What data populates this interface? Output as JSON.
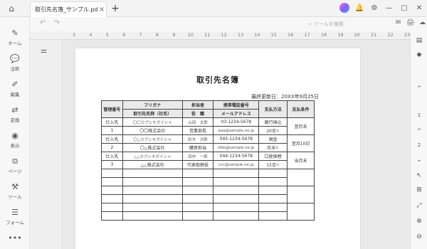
{
  "titlebar": {
    "tab_title": "取引先名簿_サンプル.pdf",
    "tab_close": "×",
    "tab_add": "+",
    "home_icon": "⌂",
    "right_icons": [
      "bell-icon",
      "gear-icon",
      "minimize-icon",
      "restore-icon",
      "close-icon"
    ],
    "right_glyphs": [
      "🔔",
      "⚙",
      "—",
      "▢",
      "✕"
    ]
  },
  "sidebar": {
    "items": [
      {
        "icon": "✎",
        "label": "ホーム",
        "name": "home"
      },
      {
        "icon": "💬",
        "label": "注釈",
        "name": "annotate"
      },
      {
        "icon": "✐",
        "label": "編集",
        "name": "edit"
      },
      {
        "icon": "⇄",
        "label": "変換",
        "name": "convert"
      },
      {
        "icon": "◉",
        "label": "表示",
        "name": "view"
      },
      {
        "icon": "⧉",
        "label": "ページ",
        "name": "page"
      },
      {
        "icon": "⚒",
        "label": "ツール",
        "name": "tool"
      },
      {
        "icon": "☰",
        "label": "フォーム",
        "name": "form"
      },
      {
        "icon": "•••",
        "label": "",
        "name": "more"
      }
    ]
  },
  "toolbar": {
    "undo": "↶",
    "redo": "↷",
    "search_placeholder": "ツールを検索",
    "right": [
      "✉",
      "🖨",
      "☁",
      "⤓"
    ]
  },
  "ruler": {
    "numbers": [
      "3",
      "4",
      "5",
      "6",
      "7",
      "8",
      "9",
      "10",
      "11",
      "12",
      "13",
      "14",
      "15",
      "16",
      "17",
      "18",
      "19",
      "20",
      "21",
      "22",
      "23"
    ]
  },
  "document": {
    "title": "取引先名簿",
    "updated": "最終更新日：20XX年9月25日",
    "headers": {
      "mgmt": "管理番号",
      "furigana": "フリガナ",
      "company": "取引先名称（社名）",
      "person": "担当者",
      "position": "役　職",
      "phone": "携帯電話番号",
      "email": "メールアドレス",
      "method": "支払方法",
      "terms": "支払条件"
    },
    "rows": [
      {
        "mgmt": "仕入先",
        "num": "1",
        "furigana": "〇〇カブシキガイシャ",
        "company": "〇〇株式会社",
        "person": "山田　太郎",
        "position": "営業部長",
        "phone": "03-1234-5678",
        "email": "aaa@sample.ne.jp",
        "method1": "銀行振込",
        "method2": "20日",
        "terms": "翌月末"
      },
      {
        "mgmt": "仕入先",
        "num": "2",
        "furigana": "〇△カブシキガイシャ",
        "company": "〇△株式会社",
        "person": "鈴木　次郎",
        "position": "購買担当",
        "phone": "045-1234-5678",
        "email": "bbb@sample.ne.jp",
        "method1": "現金",
        "method2": "月末",
        "terms": "翌月10日"
      },
      {
        "mgmt": "仕入先",
        "num": "3",
        "furigana": "△△カブシキガイシャ",
        "company": "△△株式会社",
        "person": "田中　一郎",
        "position": "代表取締役",
        "phone": "044-1234-5678",
        "email": "ccc@sample.ne.jp",
        "method1": "口座振替",
        "method2": "15日",
        "terms": "当月末"
      }
    ]
  },
  "right_bar": {
    "page_numbers": [
      "1",
      "2"
    ]
  }
}
